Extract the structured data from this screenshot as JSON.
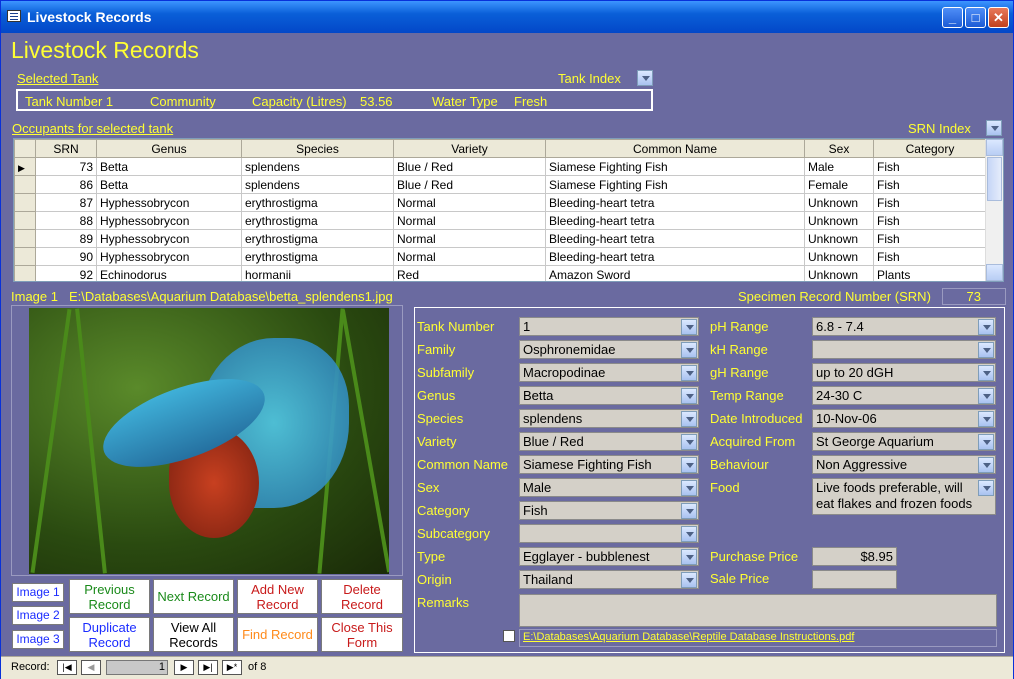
{
  "window": {
    "title": "Livestock Records"
  },
  "form": {
    "title": "Livestock Records",
    "selected_tank_link": "Selected Tank",
    "tank_index_label": "Tank Index",
    "tank": {
      "number": "Tank Number 1",
      "type": "Community",
      "capacity_label": "Capacity (Litres)",
      "capacity_value": "53.56",
      "water_type_label": "Water Type",
      "water_type_value": "Fresh"
    },
    "occupants_link": "Occupants for selected tank",
    "srn_index_label": "SRN Index"
  },
  "grid": {
    "columns": [
      "SRN",
      "Genus",
      "Species",
      "Variety",
      "Common Name",
      "Sex",
      "Category"
    ],
    "rows": [
      [
        "73",
        "Betta",
        "splendens",
        "Blue / Red",
        "Siamese Fighting Fish",
        "Male",
        "Fish"
      ],
      [
        "86",
        "Betta",
        "splendens",
        "Blue / Red",
        "Siamese Fighting Fish",
        "Female",
        "Fish"
      ],
      [
        "87",
        "Hyphessobrycon",
        "erythrostigma",
        "Normal",
        "Bleeding-heart tetra",
        "Unknown",
        "Fish"
      ],
      [
        "88",
        "Hyphessobrycon",
        "erythrostigma",
        "Normal",
        "Bleeding-heart tetra",
        "Unknown",
        "Fish"
      ],
      [
        "89",
        "Hyphessobrycon",
        "erythrostigma",
        "Normal",
        "Bleeding-heart tetra",
        "Unknown",
        "Fish"
      ],
      [
        "90",
        "Hyphessobrycon",
        "erythrostigma",
        "Normal",
        "Bleeding-heart tetra",
        "Unknown",
        "Fish"
      ],
      [
        "92",
        "Echinodorus",
        "hormanii",
        "Red",
        "Amazon Sword",
        "Unknown",
        "Plants"
      ]
    ]
  },
  "image": {
    "label": "Image 1",
    "path": "E:\\Databases\\Aquarium Database\\betta_splendens1.jpg",
    "srn_label": "Specimen Record Number (SRN)",
    "srn_value": "73"
  },
  "image_buttons": [
    "Image 1",
    "Image 2",
    "Image 3"
  ],
  "nav_buttons": {
    "previous": "Previous Record",
    "next": "Next Record",
    "add_new": "Add New Record",
    "delete": "Delete Record",
    "duplicate": "Duplicate Record",
    "view_all": "View All Records",
    "find": "Find Record",
    "close": "Close This Form"
  },
  "fields_left": [
    {
      "label": "Tank Number",
      "value": "1"
    },
    {
      "label": "Family",
      "value": "Osphronemidae"
    },
    {
      "label": "Subfamily",
      "value": "Macropodinae"
    },
    {
      "label": "Genus",
      "value": "Betta"
    },
    {
      "label": "Species",
      "value": "splendens"
    },
    {
      "label": "Variety",
      "value": "Blue / Red"
    },
    {
      "label": "Common Name",
      "value": "Siamese Fighting Fish"
    },
    {
      "label": "Sex",
      "value": "Male"
    },
    {
      "label": "Category",
      "value": "Fish"
    },
    {
      "label": "Subcategory",
      "value": ""
    },
    {
      "label": "Type",
      "value": "Egglayer - bubblenest"
    },
    {
      "label": "Origin",
      "value": "Thailand"
    }
  ],
  "fields_right": [
    {
      "label": "pH Range",
      "value": "6.8 - 7.4"
    },
    {
      "label": "kH Range",
      "value": ""
    },
    {
      "label": "gH Range",
      "value": "up to 20 dGH"
    },
    {
      "label": "Temp Range",
      "value": "24-30 C"
    },
    {
      "label": "Date Introduced",
      "value": "10-Nov-06"
    },
    {
      "label": "Acquired From",
      "value": "St George Aquarium"
    },
    {
      "label": "Behaviour",
      "value": "Non Aggressive"
    }
  ],
  "food": {
    "label": "Food",
    "value": "Live foods preferable, will eat flakes and frozen foods"
  },
  "purchase_price": {
    "label": "Purchase Price",
    "value": "$8.95"
  },
  "sale_price": {
    "label": "Sale Price",
    "value": ""
  },
  "remarks": {
    "label": "Remarks",
    "value": ""
  },
  "instructions_link": "E:\\Databases\\Aquarium Database\\Reptile Database Instructions.pdf",
  "record_nav": {
    "label": "Record:",
    "current": "1",
    "of_text": "of 8"
  },
  "colors": {
    "label_yellow": "#ffff33",
    "form_bg": "#6a6aa0",
    "titlebar_blue": "#0a5fd8"
  }
}
